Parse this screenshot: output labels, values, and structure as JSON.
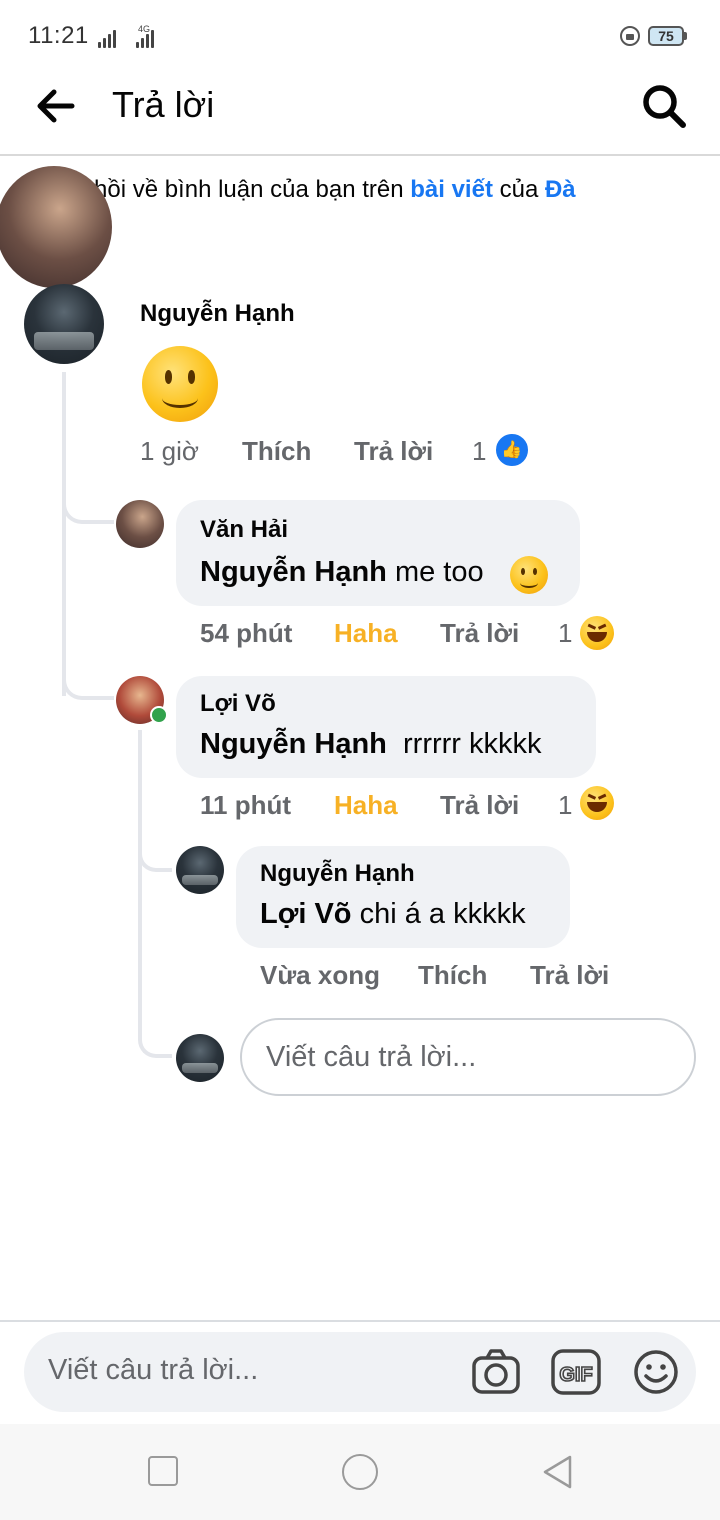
{
  "status_bar": {
    "time": "11:21",
    "network": "4G",
    "battery": "75"
  },
  "header": {
    "title": "Trả lời"
  },
  "notice": {
    "text_pre": "hồi về bình luận của bạn trên ",
    "link_post": "bài viết",
    "text_mid": " của ",
    "link_name": "Đà"
  },
  "comments": [
    {
      "author": "Nguyễn Hạnh",
      "time": "1 giờ",
      "like_label": "Thích",
      "reply_label": "Trả lời",
      "reaction_count": "1",
      "reaction": "like"
    }
  ],
  "replies": [
    {
      "author": "Văn Hải",
      "mention": "Nguyễn Hạnh",
      "text": " me too",
      "time": "54 phút",
      "like_label": "Haha",
      "reply_label": "Trả lời",
      "reaction_count": "1",
      "reaction": "haha"
    },
    {
      "author": "Lợi Võ",
      "mention": "Nguyễn Hạnh",
      "text": "  rrrrrr kkkkk",
      "time": "11 phút",
      "like_label": "Haha",
      "reply_label": "Trả lời",
      "reaction_count": "1",
      "reaction": "haha",
      "online": true
    },
    {
      "author": "Nguyễn Hạnh",
      "mention": "Lợi Võ",
      "text": " chi á a kkkkk",
      "time": "Vừa xong",
      "like_label": "Thích",
      "reply_label": "Trả lời"
    }
  ],
  "reply_box": {
    "placeholder": "Viết câu trả lời..."
  },
  "composer": {
    "placeholder": "Viết câu trả lời..."
  },
  "colors": {
    "link": "#1877f2",
    "haha": "#f7b125",
    "meta": "#65676b",
    "bubble": "#f0f2f5"
  }
}
